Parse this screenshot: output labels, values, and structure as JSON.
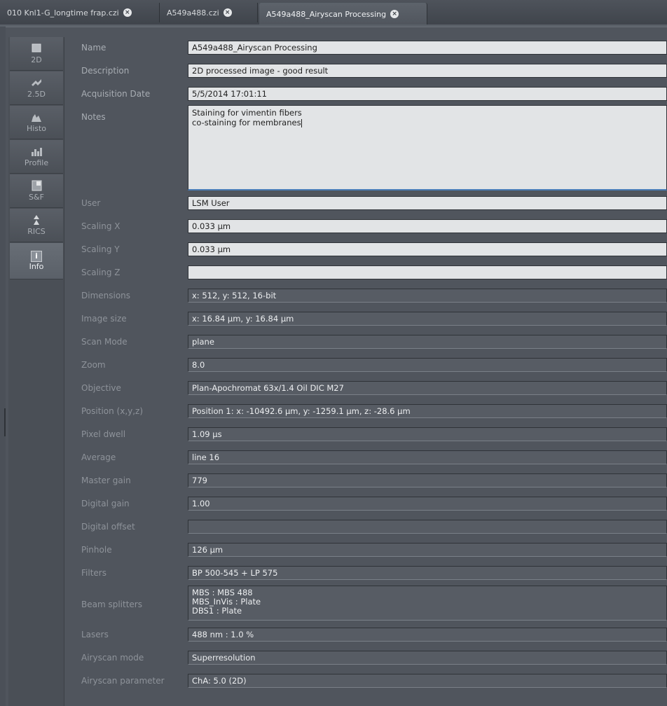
{
  "tabs": [
    {
      "label": "010 Knl1-G_longtime frap.czi",
      "close": "×"
    },
    {
      "label": "A549a488.czi",
      "close": "×"
    },
    {
      "label": "A549a488_Airyscan Processing",
      "close": "×"
    }
  ],
  "sidebar": {
    "items": [
      {
        "label": "2D",
        "icon": "image-2d-icon"
      },
      {
        "label": "2.5D",
        "icon": "surface-2-5d-icon"
      },
      {
        "label": "Histo",
        "icon": "histogram-icon"
      },
      {
        "label": "Profile",
        "icon": "profile-icon"
      },
      {
        "label": "S&F",
        "icon": "lut-sf-icon"
      },
      {
        "label": "RICS",
        "icon": "rics-icon"
      },
      {
        "label": "Info",
        "icon": "info-icon",
        "glyph": "i"
      }
    ]
  },
  "labels": {
    "name": "Name",
    "description": "Description",
    "acquisition_date": "Acquisition Date",
    "notes": "Notes",
    "user": "User",
    "scaling_x": "Scaling X",
    "scaling_y": "Scaling Y",
    "scaling_z": "Scaling Z",
    "dimensions": "Dimensions",
    "image_size": "Image size",
    "scan_mode": "Scan Mode",
    "zoom": "Zoom",
    "objective": "Objective",
    "position": "Position (x,y,z)",
    "pixel_dwell": "Pixel dwell",
    "average": "Average",
    "master_gain": "Master gain",
    "digital_gain": "Digital gain",
    "digital_offset": "Digital offset",
    "pinhole": "Pinhole",
    "filters": "Filters",
    "beam_splitters": "Beam splitters",
    "lasers": "Lasers",
    "airyscan_mode": "Airyscan mode",
    "airyscan_parameter": "Airyscan parameter"
  },
  "values": {
    "name": "A549a488_Airyscan Processing",
    "description": "2D processed image - good result",
    "acquisition_date": "5/5/2014 17:01:11",
    "notes": "Staining for vimentin fibers\nco-staining for membranes",
    "user": "LSM User",
    "scaling_x": "0.033 µm",
    "scaling_y": "0.033 µm",
    "scaling_z": "",
    "dimensions": "x: 512, y: 512, 16-bit",
    "image_size": "x: 16.84 µm, y: 16.84 µm",
    "scan_mode": "plane",
    "zoom": "8.0",
    "objective": "Plan-Apochromat 63x/1.4 Oil DIC M27",
    "position": "Position 1: x: -10492.6 µm, y: -1259.1 µm, z: -28.6 µm",
    "pixel_dwell": "1.09 µs",
    "average": "line 16",
    "master_gain": "779",
    "digital_gain": "1.00",
    "digital_offset": "",
    "pinhole": "126 µm",
    "filters": "BP 500-545 + LP 575",
    "beam_splitters": "MBS : MBS 488\nMBS_InVis : Plate\nDBS1 : Plate",
    "lasers": "488 nm : 1.0 %",
    "airyscan_mode": "Superresolution",
    "airyscan_parameter": "ChA: 5.0 (2D)"
  }
}
